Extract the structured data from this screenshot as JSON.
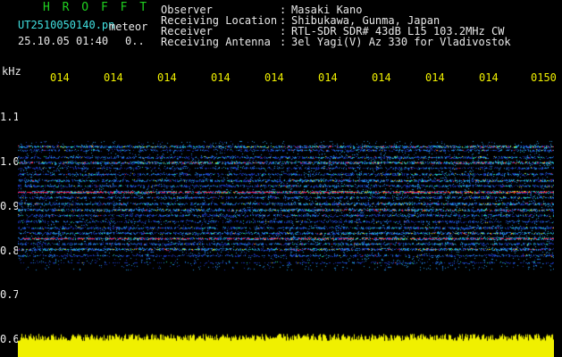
{
  "header": {
    "program": "H R O F F T",
    "filename": "UT2510050140.pn",
    "meteor_label": "meteor",
    "datetime": "25.10.05 01:40",
    "count": "0..",
    "meta": [
      {
        "label": "Observer",
        "value": "Masaki Kano"
      },
      {
        "label": "Receiving Location",
        "value": "Shibukawa, Gunma, Japan"
      },
      {
        "label": "Receiver",
        "value": "RTL-SDR SDR# 43dB L15 103.2MHz CW"
      },
      {
        "label": "Receiving Antenna",
        "value": "3el Yagi(V) Az 330 for Vladivostok"
      }
    ]
  },
  "time_axis": {
    "ticks": [
      "014",
      "014",
      "014",
      "014",
      "014",
      "014",
      "014",
      "014",
      "014",
      "0150"
    ]
  },
  "freq_axis": {
    "unit": "kHz",
    "labels": [
      "1.1",
      "1.0",
      "0.9",
      "0.8",
      "0.7",
      "0.6"
    ]
  },
  "colors": {
    "background": "#000000",
    "tick_text": "#f0f000",
    "header_text": "#e8e8e8",
    "amplitude": "#f0f000"
  }
}
